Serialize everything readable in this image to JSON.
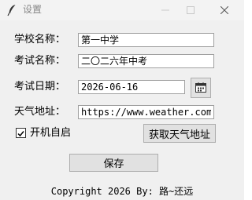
{
  "window": {
    "title": "设置",
    "icons": {
      "app": "feather-icon",
      "minimize": "minimize-icon",
      "maximize": "maximize-icon",
      "close": "close-icon"
    }
  },
  "form": {
    "school_label": "学校名称：",
    "school_value": "第一中学",
    "exam_label": "考试名称：",
    "exam_value": "二〇二六年中考",
    "date_label": "考试日期：",
    "date_value": "2026-06-16",
    "calendar_icon": "calendar-icon",
    "weather_label": "天气地址：",
    "weather_value": "https://www.weather.com.c",
    "autostart_label": "开机自启",
    "autostart_checked": true,
    "fetch_weather_button": "获取天气地址",
    "save_button": "保存"
  },
  "footer": {
    "copyright": "Copyright 2026 By: 路~还远"
  }
}
